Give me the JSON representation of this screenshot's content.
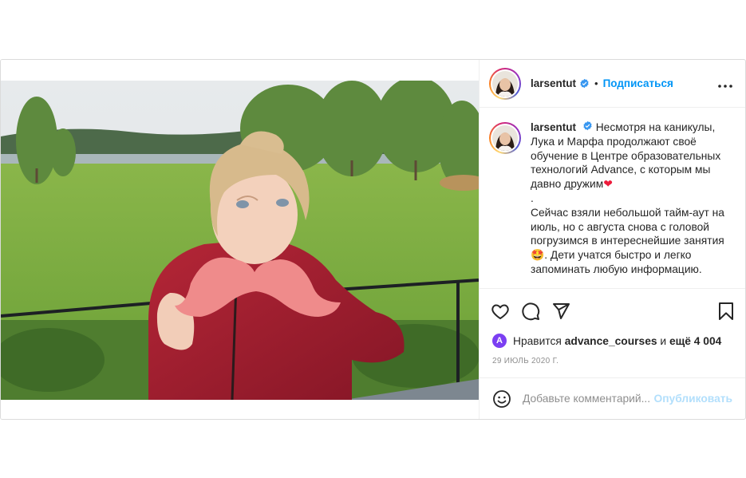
{
  "post": {
    "author": {
      "username": "larsentut",
      "verified": true,
      "follow_label": "Подписаться",
      "separator": "•"
    },
    "caption_lines": [
      "Несмотря на каникулы,",
      "Лука и Марфа продолжают своё",
      "обучение в Центре образовательных",
      "технологий Advance, с которым мы",
      "давно дружим",
      ".",
      "Сейчас взяли небольшой тайм-аут на",
      "июль, но с августа снова с головой",
      "погрузимся в интереснейшие занятия",
      ". Дети учатся быстро и легко",
      "запоминать любую информацию."
    ],
    "caption_emojis": [
      "❤",
      "🤩"
    ],
    "likes": {
      "prefix": "Нравится",
      "liker": "advance_courses",
      "middle": "и",
      "others": "ещё 4 004",
      "liker_initial": "A"
    },
    "date": "29 ИЮЛЬ 2020 Г.",
    "comment_box": {
      "placeholder": "Добавьте комментарий...",
      "publish_label": "Опубликовать"
    }
  },
  "icons": {
    "more": "more-options-icon",
    "verified": "verified-badge-icon",
    "like": "heart-icon",
    "comment": "comment-icon",
    "share": "share-icon",
    "save": "bookmark-icon",
    "emoji": "emoji-icon"
  },
  "colors": {
    "accent": "#0095f6",
    "publish_disabled": "#b2dffc",
    "muted": "#8e8e8e",
    "border": "#dbdbdb"
  }
}
